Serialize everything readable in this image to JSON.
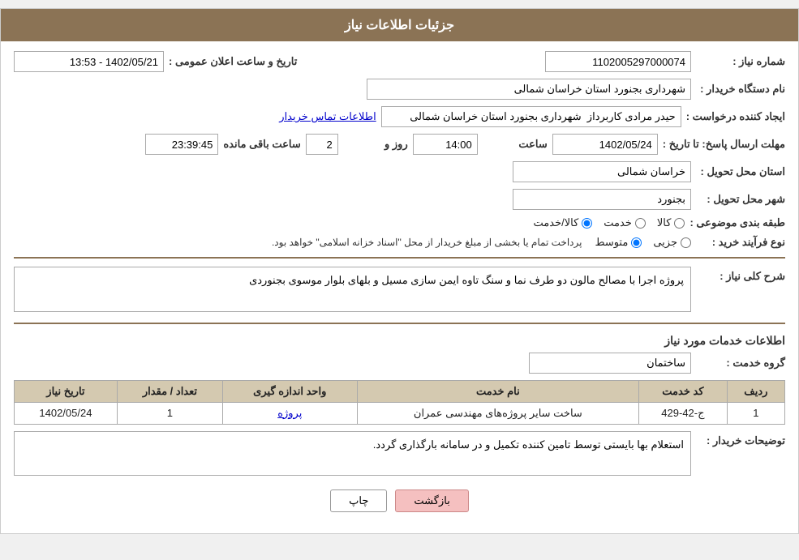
{
  "header": {
    "title": "جزئیات اطلاعات نیاز"
  },
  "fields": {
    "need_number_label": "شماره نیاز :",
    "need_number_value": "1102005297000074",
    "org_name_label": "نام دستگاه خریدار :",
    "org_name_value": "شهرداری بجنورد استان خراسان شمالی",
    "creator_label": "ایجاد کننده درخواست :",
    "creator_value": "حیدر مرادی کاربرداز  شهرداری بجنورد استان خراسان شمالی",
    "contact_link": "اطلاعات تماس خریدار",
    "deadline_label": "مهلت ارسال پاسخ: تا تاریخ :",
    "deadline_date": "1402/05/24",
    "deadline_time": "14:00",
    "deadline_days": "2",
    "deadline_remaining": "23:39:45",
    "deadline_date_label": "",
    "deadline_time_label": "ساعت",
    "deadline_days_label": "روز و",
    "deadline_remaining_label": "ساعت باقی مانده",
    "announce_label": "تاریخ و ساعت اعلان عمومی :",
    "announce_value": "1402/05/21 - 13:53",
    "province_label": "استان محل تحویل :",
    "province_value": "خراسان شمالی",
    "city_label": "شهر محل تحویل :",
    "city_value": "بجنورد",
    "category_label": "طبقه بندی موضوعی :",
    "category_kala": "کالا",
    "category_khedmat": "خدمت",
    "category_kala_khedmat": "کالا/خدمت",
    "process_label": "نوع فرآیند خرید :",
    "process_jazei": "جزیی",
    "process_motevaset": "متوسط",
    "process_note": "پرداخت تمام یا بخشی از مبلغ خریدار از محل \"اسناد خزانه اسلامی\" خواهد بود.",
    "need_desc_label": "شرح کلی نیاز :",
    "need_desc_value": "پروژه اجرا با مصالح مالون دو طرف نما و سنگ تاوه ایمن سازی مسیل و بلهای بلوار موسوی بجنوردی",
    "service_info_title": "اطلاعات خدمات مورد نیاز",
    "service_group_label": "گروه خدمت :",
    "service_group_value": "ساختمان",
    "table_headers": {
      "row_num": "ردیف",
      "service_code": "کد خدمت",
      "service_name": "نام خدمت",
      "unit": "واحد اندازه گیری",
      "qty": "تعداد / مقدار",
      "need_date": "تاریخ نیاز"
    },
    "table_rows": [
      {
        "row_num": "1",
        "service_code": "ج-42-429",
        "service_name": "ساخت سایر پروژه‌های مهندسی عمران",
        "unit": "پروژه",
        "qty": "1",
        "need_date": "1402/05/24"
      }
    ],
    "buyer_desc_label": "توضیحات خریدار :",
    "buyer_desc_value": "استعلام بها بایستی توسط تامین کننده تکمیل و در سامانه بارگذاری گردد.",
    "btn_print": "چاپ",
    "btn_back": "بازگشت"
  }
}
